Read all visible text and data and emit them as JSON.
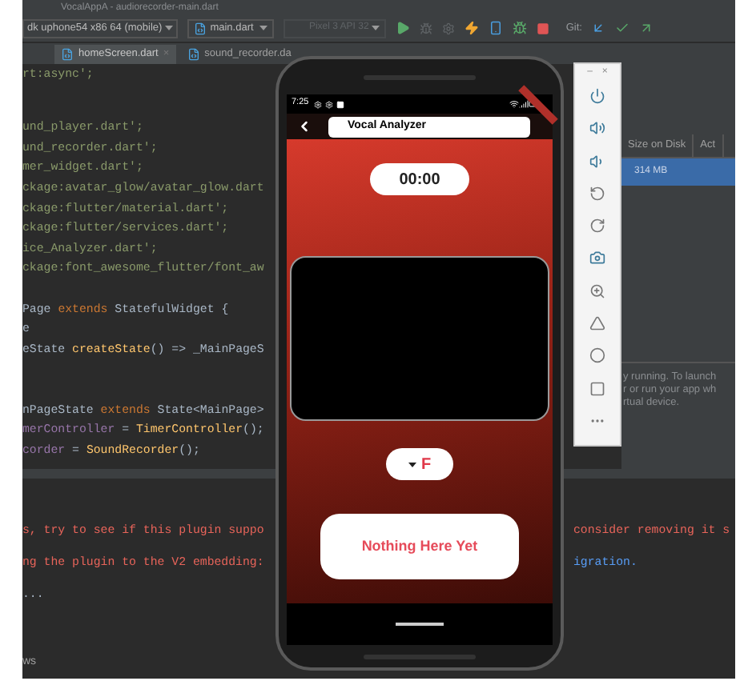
{
  "window": {
    "title": "VocalAppA - audiorecorder-main.dart"
  },
  "toolbar": {
    "device": "dk uphone54 x86 64 (mobile)",
    "run_config": "main.dart",
    "emulator": "Pixel 3 API 32",
    "git_label": "Git:"
  },
  "tabs": [
    {
      "label": "homeScreen.dart",
      "close": "×",
      "selected": true
    },
    {
      "label": "sound_recorder.da",
      "selected": false
    }
  ],
  "editor": {
    "lines": [
      {
        "kind": "code",
        "tokens": [
          {
            "kind": "string",
            "text": "rt:async';"
          }
        ]
      },
      {
        "kind": "blank"
      },
      {
        "kind": "code",
        "tokens": [
          {
            "kind": "string",
            "text": "und_player.dart';"
          }
        ]
      },
      {
        "kind": "code",
        "tokens": [
          {
            "kind": "string",
            "text": "und_recorder.dart';"
          }
        ]
      },
      {
        "kind": "code",
        "tokens": [
          {
            "kind": "string",
            "text": "mer_widget.dart';"
          }
        ]
      },
      {
        "kind": "code",
        "tokens": [
          {
            "kind": "string",
            "text": "ckage:avatar_glow/avatar_glow.dart"
          }
        ]
      },
      {
        "kind": "code",
        "tokens": [
          {
            "kind": "string",
            "text": "ckage:flutter/material.dart';"
          }
        ]
      },
      {
        "kind": "code",
        "tokens": [
          {
            "kind": "string",
            "text": "ckage:flutter/services.dart';"
          }
        ]
      },
      {
        "kind": "code",
        "tokens": [
          {
            "kind": "string",
            "text": "ice_Analyzer.dart';"
          }
        ]
      },
      {
        "kind": "code",
        "tokens": [
          {
            "kind": "string",
            "text": "ckage:font_awesome_flutter/font_aw"
          }
        ]
      },
      {
        "kind": "blank"
      },
      {
        "kind": "code",
        "tokens": [
          {
            "kind": "plain",
            "text": "Page "
          },
          {
            "kind": "keyword",
            "text": "extends"
          },
          {
            "kind": "plain",
            "text": " StatefulWidget {"
          }
        ]
      },
      {
        "kind": "code",
        "tokens": [
          {
            "kind": "plain",
            "text": "e"
          }
        ]
      },
      {
        "kind": "code",
        "tokens": [
          {
            "kind": "plain",
            "text": "eState "
          },
          {
            "kind": "method",
            "text": "createState"
          },
          {
            "kind": "plain",
            "text": "() => _MainPageS"
          }
        ]
      },
      {
        "kind": "blank"
      },
      {
        "kind": "blank"
      },
      {
        "kind": "code",
        "tokens": [
          {
            "kind": "plain",
            "text": "nPageState "
          },
          {
            "kind": "keyword",
            "text": "extends"
          },
          {
            "kind": "plain",
            "text": " State<MainPage>"
          }
        ]
      },
      {
        "kind": "code",
        "tokens": [
          {
            "kind": "field",
            "text": "merController"
          },
          {
            "kind": "plain",
            "text": " = "
          },
          {
            "kind": "method",
            "text": "TimerController"
          },
          {
            "kind": "plain",
            "text": "();"
          }
        ]
      },
      {
        "kind": "code",
        "tokens": [
          {
            "kind": "field",
            "text": "corder"
          },
          {
            "kind": "plain",
            "text": " = "
          },
          {
            "kind": "method",
            "text": "SoundRecorder"
          },
          {
            "kind": "plain",
            "text": "();"
          }
        ]
      }
    ]
  },
  "device_manager": {
    "columns": [
      "Size on Disk",
      "Act"
    ],
    "rows": [
      {
        "cells": [
          "314 MB"
        ],
        "selected": true
      }
    ],
    "message": [
      "y running. To launch",
      "r or run your app wh",
      "rtual device."
    ]
  },
  "emulator_panel": {
    "window_controls": [
      "–",
      "×"
    ]
  },
  "phone": {
    "status_time": "7:25",
    "app_title": "Vocal Analyzer",
    "timer": "00:00",
    "dropdown": "F",
    "empty_button": "Nothing Here Yet"
  },
  "console": {
    "lines": [
      {
        "kind": "error",
        "left": "s, try to see if this plugin suppo",
        "right": "consider removing it s"
      },
      {
        "kind": "error",
        "left": "ng the plugin to the V2 embedding:",
        "right": "igration.",
        "right_link": true
      },
      {
        "kind": "plain",
        "left": "..."
      }
    ],
    "bottom_tab": "ws"
  }
}
